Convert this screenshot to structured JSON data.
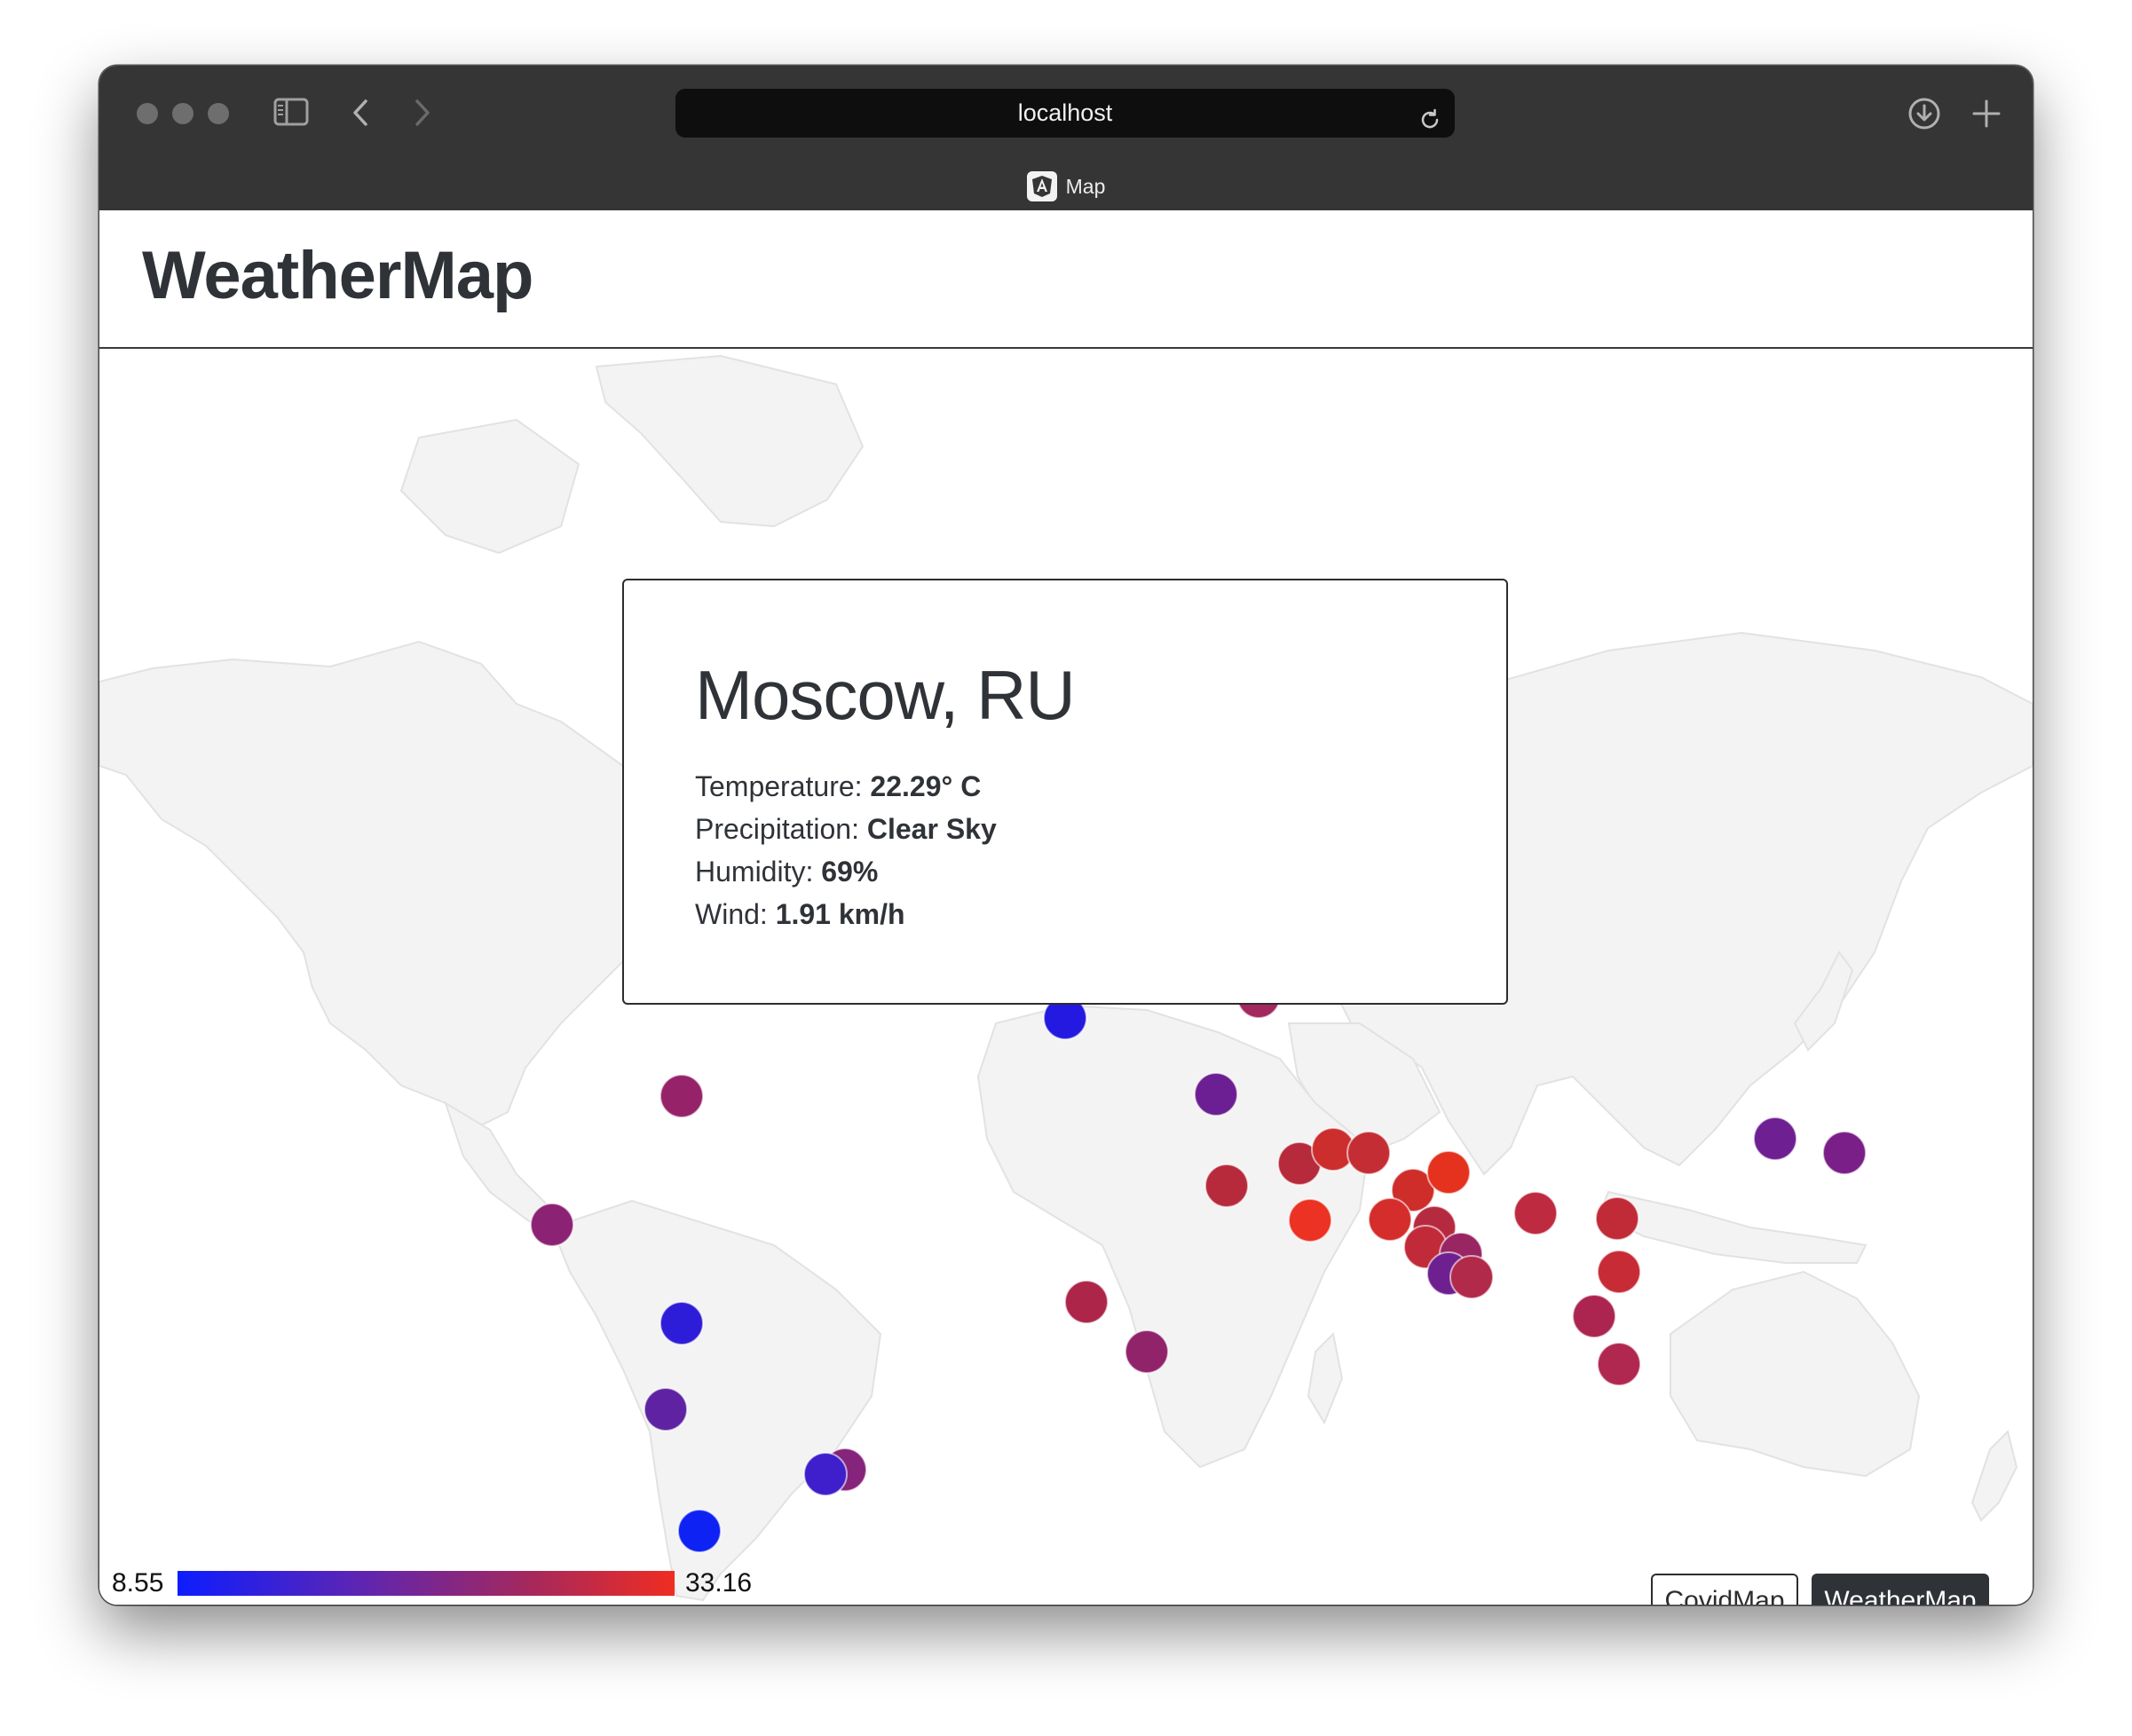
{
  "browser": {
    "url": "localhost",
    "tab_title": "Map",
    "tab_icon": "angular-logo-icon"
  },
  "app": {
    "brand": "WeatherMap"
  },
  "info_card": {
    "city": "Moscow, RU",
    "temperature_label": "Temperature:",
    "temperature_value": "22.29° C",
    "precipitation_label": "Precipitation:",
    "precipitation_value": "Clear Sky",
    "humidity_label": "Humidity:",
    "humidity_value": "69%",
    "wind_label": "Wind:",
    "wind_value": "1.91 km/h"
  },
  "legend": {
    "min": "8.55",
    "max": "33.16",
    "colors": [
      "#0d1dff",
      "#5a25b6",
      "#a3285f",
      "#ef2d22"
    ]
  },
  "buttons": {
    "covid": "CovidMap",
    "weather": "WeatherMap"
  },
  "colors": {
    "land": "#f3f3f3",
    "land_border": "#e2e2e2",
    "dark_text": "#2f3338"
  }
}
